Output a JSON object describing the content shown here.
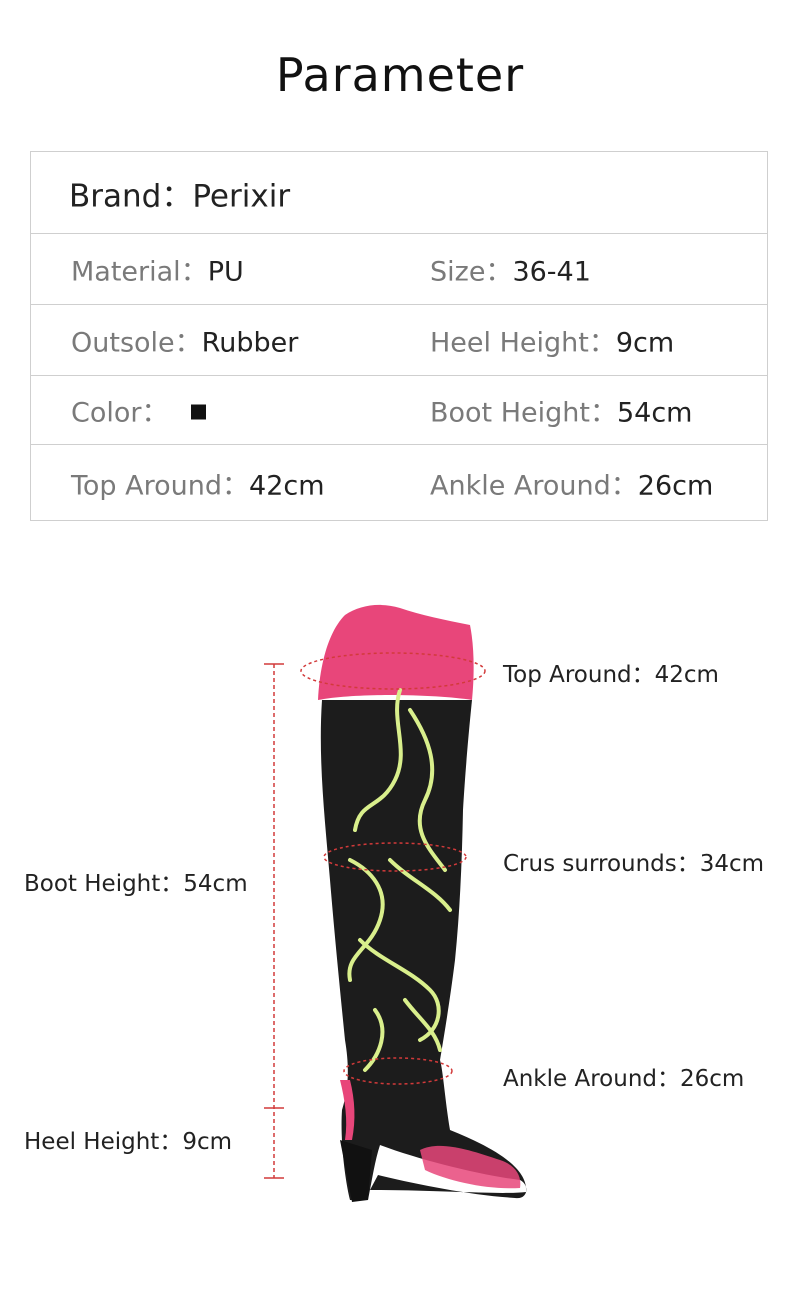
{
  "title": "Parameter",
  "params": {
    "brand": {
      "label": "Brand：",
      "value": "Perixir"
    },
    "material": {
      "label": "Material：",
      "value": "PU"
    },
    "size": {
      "label": "Size：",
      "value": "36-41"
    },
    "outsole": {
      "label": "Outsole：",
      "value": "Rubber"
    },
    "heel_height": {
      "label": "Heel Height：",
      "value": "9cm"
    },
    "color": {
      "label": "Color：",
      "swatch": "#111111"
    },
    "boot_height": {
      "label": "Boot Height：",
      "value": "54cm"
    },
    "top_around": {
      "label": "Top Around：",
      "value": "42cm"
    },
    "ankle_around": {
      "label": "Ankle Around：",
      "value": "26cm"
    }
  },
  "diagram": {
    "top_around": "Top Around：42cm",
    "crus_surrounds": "Crus surrounds：34cm",
    "ankle_around": "Ankle Around：26cm",
    "boot_height": "Boot Height：54cm",
    "heel_height": "Heel Height：9cm"
  },
  "colors": {
    "boot_body": "#1c1c1c",
    "pink": "#e8467a",
    "embroidery": "#d9ef8c",
    "measure_line": "#d23a3a"
  }
}
